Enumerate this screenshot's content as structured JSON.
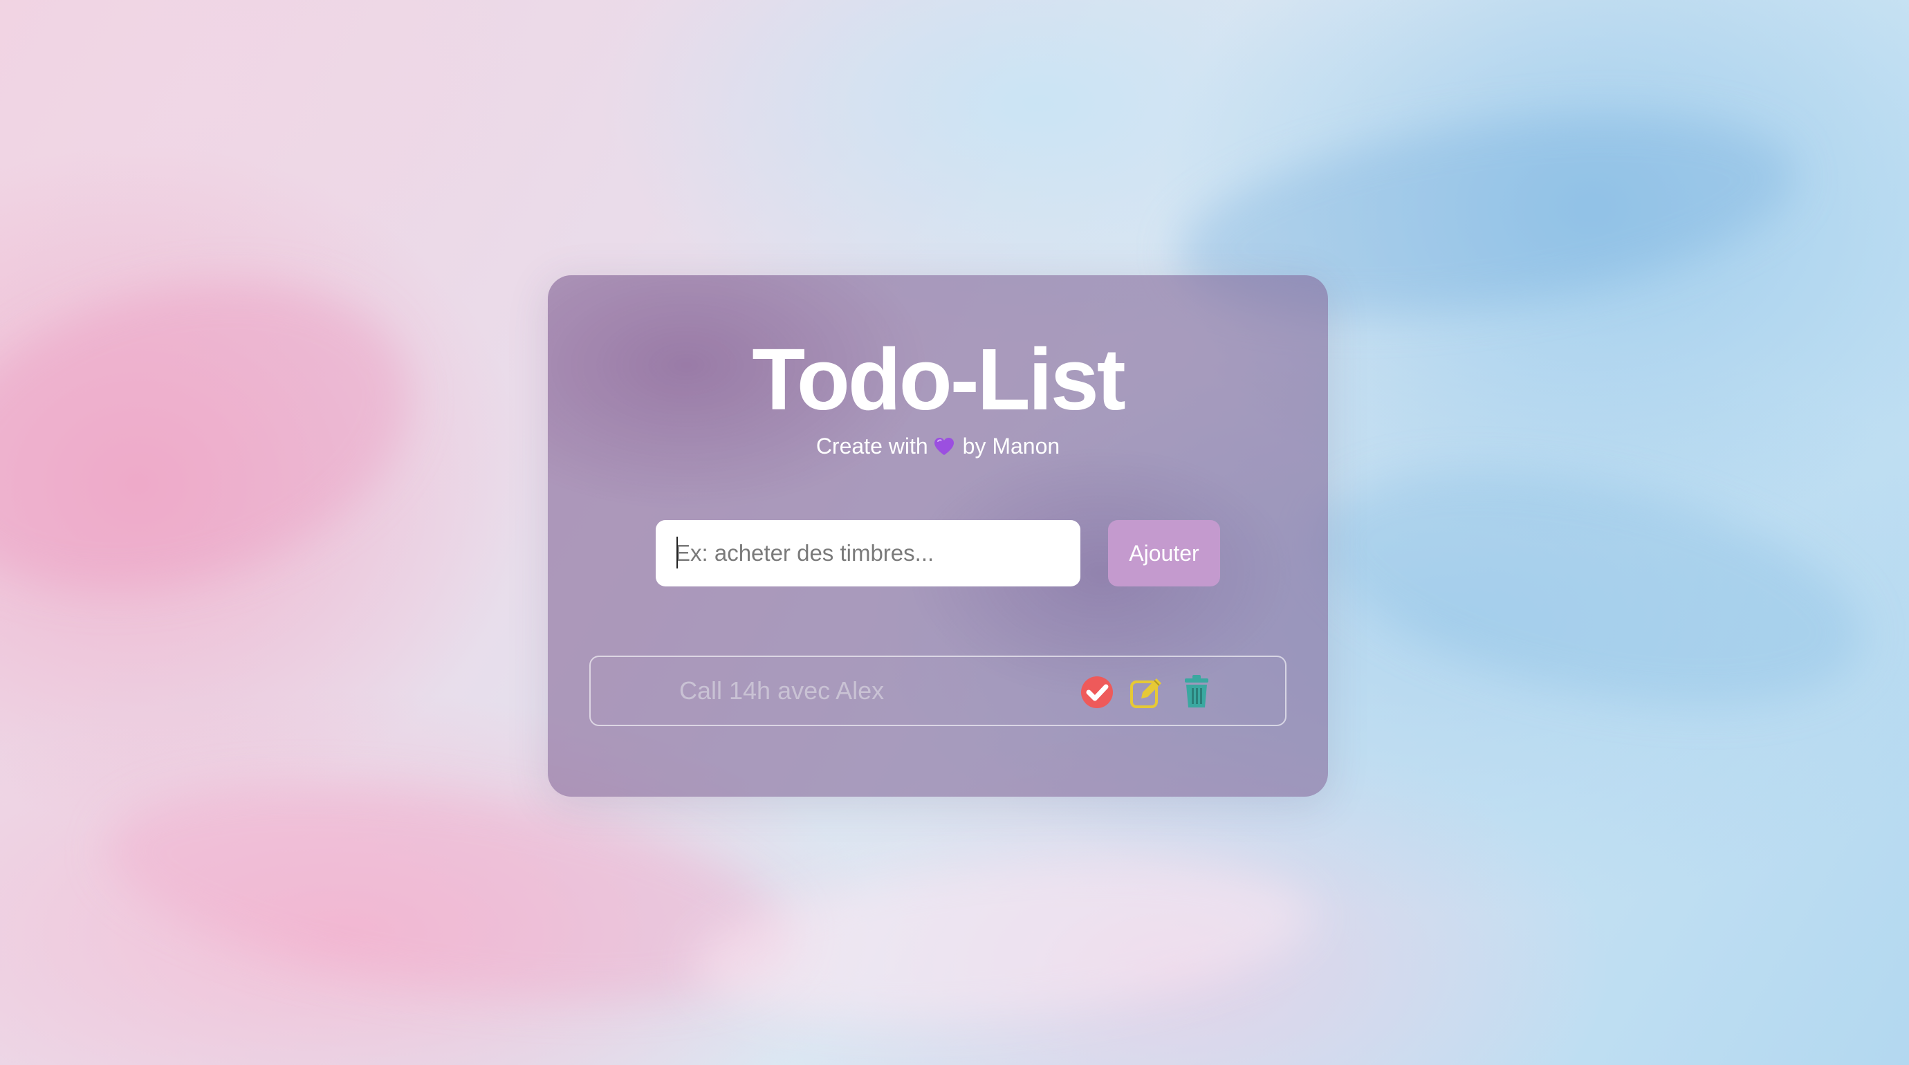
{
  "app": {
    "title": "Todo-List",
    "subtitle_prefix": "Create with",
    "subtitle_suffix": "by Manon"
  },
  "form": {
    "input_value": "",
    "input_placeholder": "Ex: acheter des timbres...",
    "add_label": "Ajouter"
  },
  "tasks": [
    {
      "text": "Call 14h avec Alex",
      "actions": [
        "check-circle-icon",
        "edit-icon",
        "trash-icon"
      ]
    }
  ],
  "colors": {
    "card": "#8c6a9c",
    "add_button": "#c49ace",
    "check": "#ee5a5a",
    "edit": "#e6c935",
    "trash": "#3aa8a0",
    "heart": "#9b4fe0"
  }
}
